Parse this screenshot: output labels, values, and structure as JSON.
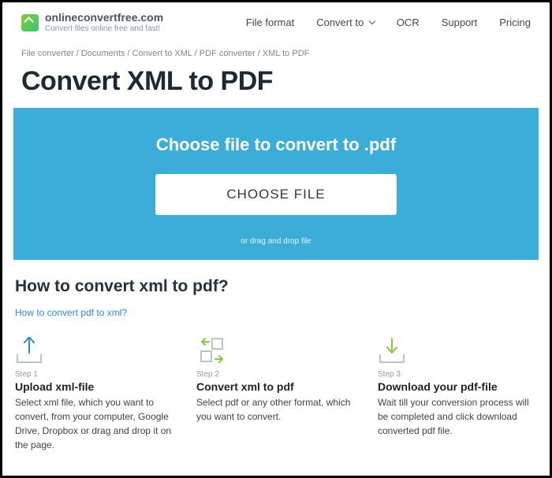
{
  "brand": {
    "name": "onlineconvertfree.com",
    "tagline": "Convert files online free and fast!"
  },
  "nav": {
    "file_format": "File format",
    "convert_to": "Convert to",
    "ocr": "OCR",
    "support": "Support",
    "pricing": "Pricing"
  },
  "breadcrumbs": "File converter / Documents / Convert to XML / PDF converter / XML to PDF",
  "page_title": "Convert XML to PDF",
  "upload": {
    "heading": "Choose file to convert to .pdf",
    "button": "CHOOSE FILE",
    "drag_hint": "or drag and drop file"
  },
  "howto": {
    "title": "How to convert xml to pdf?",
    "reverse_link": "How to convert pdf to xml?"
  },
  "steps": [
    {
      "label": "Step 1",
      "title": "Upload xml-file",
      "text": "Select xml file, which you want to convert, from your computer, Google Drive, Dropbox or drag and drop it on the page."
    },
    {
      "label": "Step 2",
      "title": "Convert xml to pdf",
      "text": "Select pdf or any other format, which you want to convert."
    },
    {
      "label": "Step 3",
      "title": "Download your pdf-file",
      "text": "Wait till your conversion process will be completed and click download converted pdf file."
    }
  ]
}
